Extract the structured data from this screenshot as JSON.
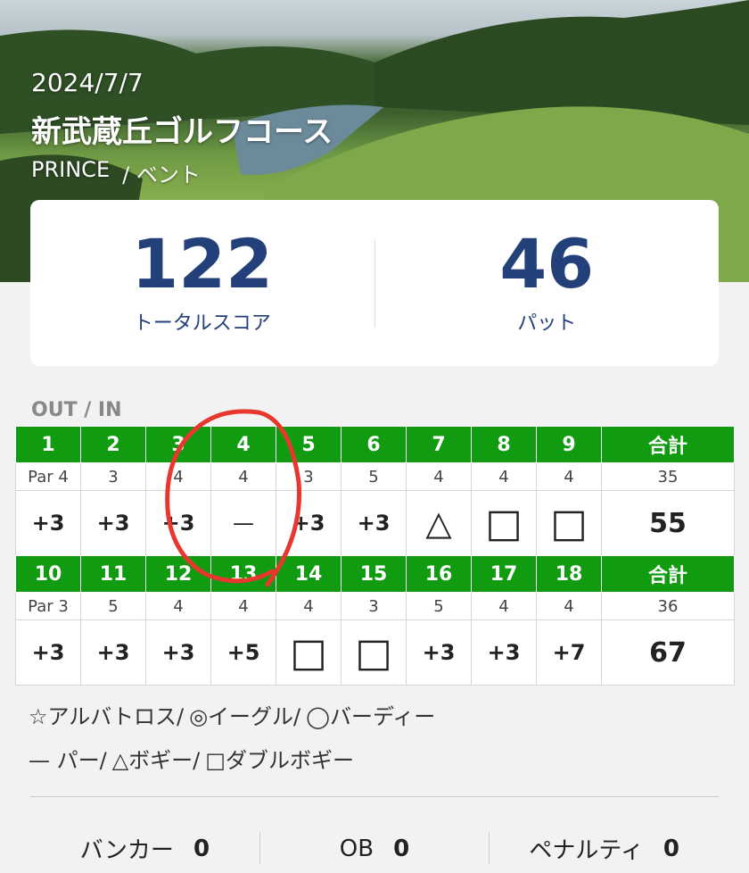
{
  "header": {
    "date": "2024/7/7",
    "course_name": "新武蔵丘ゴルフコース",
    "course_sub": "PRINCE",
    "tee": "/ ベント"
  },
  "summary": {
    "total_score": "122",
    "total_label": "トータルスコア",
    "putts": "46",
    "putts_label": "パット"
  },
  "scorecard": {
    "section_title": "OUT / IN",
    "out": {
      "holes": [
        "1",
        "2",
        "3",
        "4",
        "5",
        "6",
        "7",
        "8",
        "9",
        "合計"
      ],
      "par": [
        "Par 4",
        "3",
        "4",
        "4",
        "3",
        "5",
        "4",
        "4",
        "4",
        "35"
      ],
      "scores": [
        "+3",
        "+3",
        "+3",
        "—",
        "+3",
        "+3",
        "△",
        "□",
        "□",
        "55"
      ]
    },
    "in": {
      "holes": [
        "10",
        "11",
        "12",
        "13",
        "14",
        "15",
        "16",
        "17",
        "18",
        "合計"
      ],
      "par": [
        "Par 3",
        "5",
        "4",
        "4",
        "4",
        "3",
        "5",
        "4",
        "4",
        "36"
      ],
      "scores": [
        "+3",
        "+3",
        "+3",
        "+5",
        "□",
        "□",
        "+3",
        "+3",
        "+7",
        "67"
      ]
    }
  },
  "legend": {
    "albatross": "☆アルバトロス/",
    "eagle": "◎イーグル/",
    "birdie": "◯バーディー",
    "par": "— パー/",
    "bogey": "△ボギー/",
    "double": "□ダブルボギー"
  },
  "stats": {
    "bunker_label": "バンカー",
    "bunker": "0",
    "ob_label": "OB",
    "ob": "0",
    "penalty_label": "ペナルティ",
    "penalty": "0"
  },
  "colors": {
    "accent_green": "#109b10",
    "score_blue": "#24407a",
    "annotation_red": "#e8372e"
  }
}
